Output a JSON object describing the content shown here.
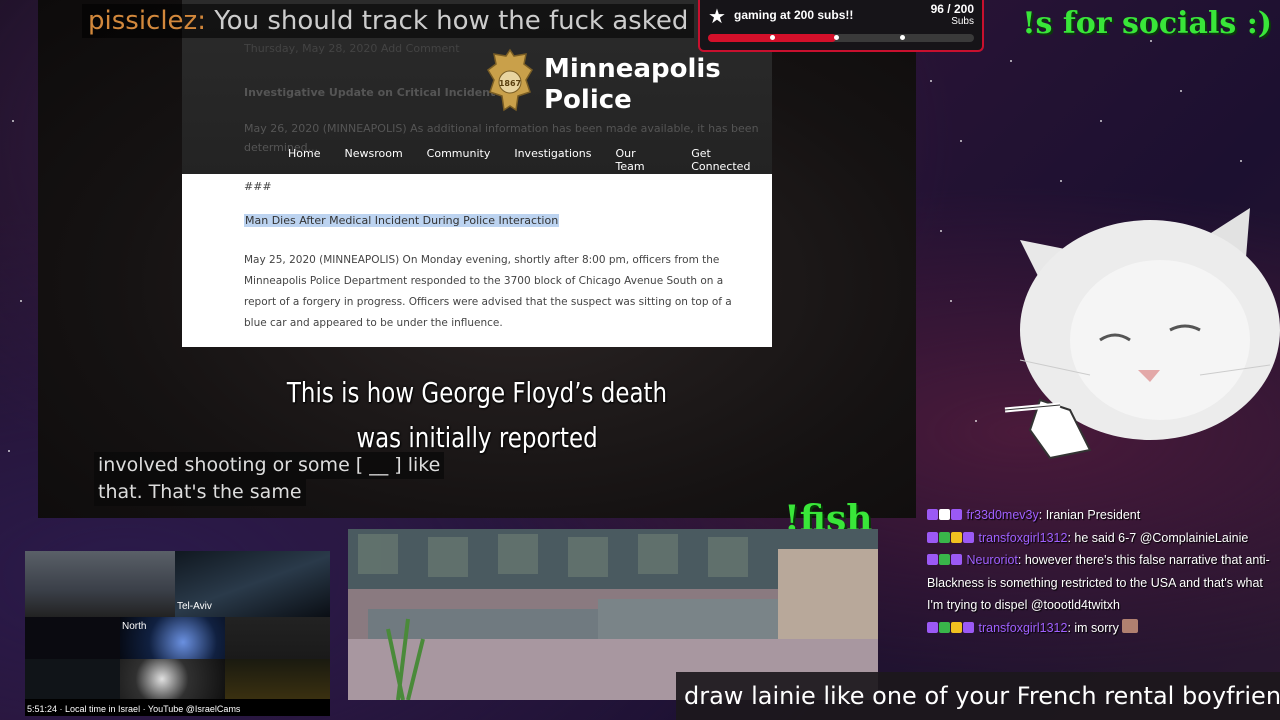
{
  "top_chat": {
    "user": "pissiclez:",
    "message": "You should track how the fuck asked"
  },
  "subgoal": {
    "label": "gaming at 200 subs!!",
    "count": "96 / 200",
    "unit": "Subs",
    "progress": 0.48,
    "markers": [
      0.24,
      0.48,
      0.73
    ]
  },
  "socials": "!s for socials :)",
  "website": {
    "bg_date": "Thursday, May 28, 2020   Add Comment",
    "bg_heading": "Investigative Update on Critical Incident",
    "bg_line1": "May 26, 2020 (MINNEAPOLIS) As additional information has been made available, it has been",
    "bg_line2": "determined...",
    "logo_year": "1867",
    "title_line1": "Minneapolis",
    "title_line2": "Police",
    "nav": [
      "Home",
      "Newsroom",
      "Community",
      "Investigations",
      "Our Team",
      "Get Connected"
    ]
  },
  "press": {
    "hash": "###",
    "headline": "Man Dies After Medical Incident During Police Interaction",
    "body": "May 25, 2020 (MINNEAPOLIS) On Monday evening, shortly after 8:00 pm, officers from the Minneapolis Police Department responded to the 3700 block of Chicago Avenue South on a report of a forgery in progress.  Officers were advised that the suspect was sitting on top of a blue car and appeared to be under the influence."
  },
  "subtitle": {
    "line1": "This is how George Floyd’s death",
    "line2": "was initially reported"
  },
  "captions": {
    "line1": "involved shooting or some [ __ ] like",
    "line2": "that. That's the same"
  },
  "fish": "!fish",
  "chat": [
    {
      "user": "fr33d0mev3y",
      "sep": ": ",
      "message": "Iranian President",
      "badges": [
        "#9b59f5",
        "#ffffff",
        "#9b59f5"
      ]
    },
    {
      "user": "transfoxgirl1312",
      "sep": ": ",
      "message": "he said 6-7 @ComplainieLainie",
      "badges": [
        "#9b59f5",
        "#39b54a",
        "#f0c020",
        "#9b59f5"
      ]
    },
    {
      "user": "Neuroriot",
      "sep": ": ",
      "message": "however there's this false narrative that anti-Blackness is something restricted to the USA and that's what I'm trying to dispel @toootld4twitxh",
      "badges": [
        "#9b59f5",
        "#39b54a",
        "#9b59f5"
      ]
    },
    {
      "user": "transfoxgirl1312",
      "sep": ": ",
      "message": "im sorry",
      "badges": [
        "#9b59f5",
        "#39b54a",
        "#f0c020",
        "#9b59f5"
      ]
    }
  ],
  "cams": {
    "label_tel_aviv": "Tel-Aviv",
    "label_north": "North",
    "time": "5:51:24",
    "local": "Local time in Israel",
    "source": "YouTube @IsraelCams"
  },
  "banner": "draw lainie like one of your French rental boyfriends"
}
